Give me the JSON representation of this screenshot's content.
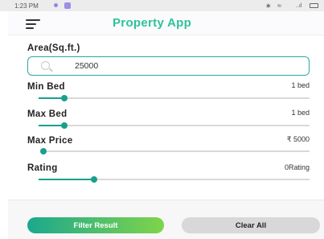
{
  "status_bar": {
    "time": "1:23 PM",
    "icons": [
      "notification-dot-icon",
      "app-notification-icon",
      "bluetooth-icon",
      "wifi-icon",
      "signal-icon",
      "battery-icon"
    ],
    "right_glyphs": [
      "∗",
      "≈",
      "..ıl"
    ]
  },
  "app": {
    "title": "Property App",
    "title_color": "#2cc39a"
  },
  "area": {
    "label": "Area(Sq.ft.)",
    "value": "25000"
  },
  "filters": [
    {
      "id": "min-bed",
      "label": "Min Bed",
      "value_text": "1 bed",
      "fraction": 0.09
    },
    {
      "id": "max-bed",
      "label": "Max Bed",
      "value_text": "1 bed",
      "fraction": 0.09
    },
    {
      "id": "max-price",
      "label": "Max Price",
      "value_text": "₹ 5000",
      "fraction": 0.0
    },
    {
      "id": "rating",
      "label": "Rating",
      "value_text": "0Rating",
      "fraction": 0.2
    }
  ],
  "buttons": {
    "filter": "Filter Result",
    "clear": "Clear All"
  },
  "colors": {
    "accent": "#1a9f8f",
    "filter_gradient_start": "#1ba88e",
    "filter_gradient_end": "#7fd44a",
    "clear_button": "#d8d8d8"
  }
}
